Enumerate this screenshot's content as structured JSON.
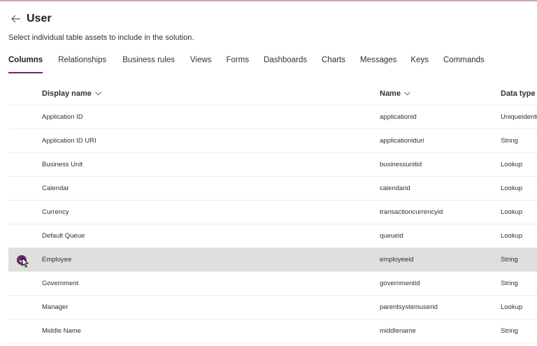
{
  "header": {
    "title": "User"
  },
  "subtitle": "Select individual table assets to include in the solution.",
  "tabs": [
    {
      "label": "Columns"
    },
    {
      "label": "Relationships"
    },
    {
      "label": "Business rules"
    },
    {
      "label": "Views"
    },
    {
      "label": "Forms"
    },
    {
      "label": "Dashboards"
    },
    {
      "label": "Charts"
    },
    {
      "label": "Messages"
    },
    {
      "label": "Keys"
    },
    {
      "label": "Commands"
    }
  ],
  "columns": {
    "display_name": "Display name",
    "name": "Name",
    "data_type": "Data type"
  },
  "rows": [
    {
      "display": "Application ID",
      "name": "applicationid",
      "type": "Uniqueidentifier"
    },
    {
      "display": "Application ID URI",
      "name": "applicationiduri",
      "type": "String"
    },
    {
      "display": "Business Unit",
      "name": "businessunitid",
      "type": "Lookup"
    },
    {
      "display": "Calendar",
      "name": "calendarid",
      "type": "Lookup"
    },
    {
      "display": "Currency",
      "name": "transactioncurrencyid",
      "type": "Lookup"
    },
    {
      "display": "Default Queue",
      "name": "queueid",
      "type": "Lookup"
    },
    {
      "display": "Employee",
      "name": "employeeid",
      "type": "String"
    },
    {
      "display": "Government",
      "name": "governmentid",
      "type": "String"
    },
    {
      "display": "Manager",
      "name": "parentsystemuserid",
      "type": "Lookup"
    },
    {
      "display": "Middle Name",
      "name": "middlename",
      "type": "String"
    }
  ],
  "colors": {
    "accent": "#6b2a6d",
    "selected_row": "#e1dfdd"
  }
}
